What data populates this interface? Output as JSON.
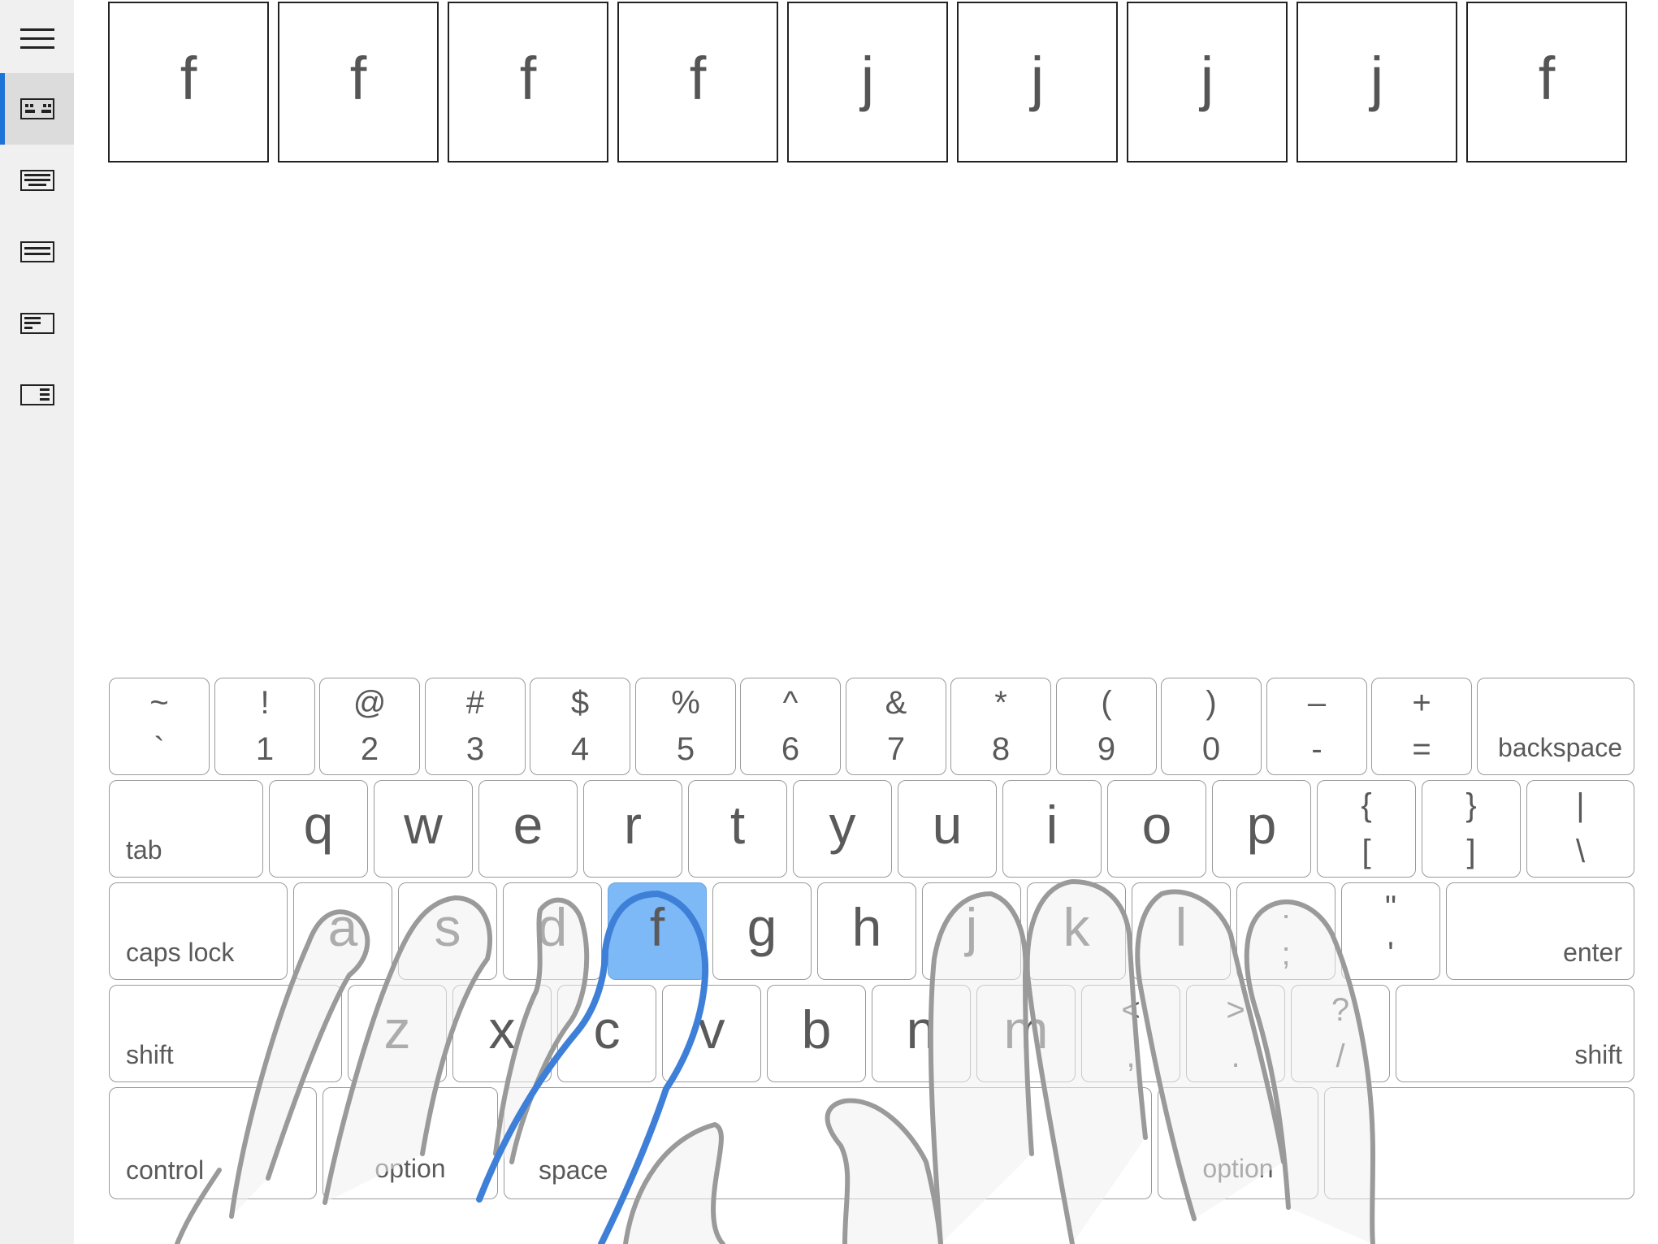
{
  "sidebar": {
    "icons": [
      {
        "name": "menu-icon",
        "active": false
      },
      {
        "name": "keyboard-home-row-icon",
        "active": true
      },
      {
        "name": "keyboard-full-icon",
        "active": false
      },
      {
        "name": "keyboard-bottom-row-icon",
        "active": false
      },
      {
        "name": "keyboard-numpad-icon",
        "active": false
      },
      {
        "name": "keyboard-right-icon",
        "active": false
      }
    ]
  },
  "exercise": {
    "letters": [
      "f",
      "f",
      "f",
      "f",
      "j",
      "j",
      "j",
      "j",
      "f"
    ]
  },
  "keyboard": {
    "highlight_color": "#7db8f7",
    "number_row": [
      {
        "top": "~",
        "bottom": "`"
      },
      {
        "top": "!",
        "bottom": "1"
      },
      {
        "top": "@",
        "bottom": "2"
      },
      {
        "top": "#",
        "bottom": "3"
      },
      {
        "top": "$",
        "bottom": "4"
      },
      {
        "top": "%",
        "bottom": "5"
      },
      {
        "top": "^",
        "bottom": "6"
      },
      {
        "top": "&",
        "bottom": "7"
      },
      {
        "top": "*",
        "bottom": "8"
      },
      {
        "top": "(",
        "bottom": "9"
      },
      {
        "top": ")",
        "bottom": "0"
      },
      {
        "top": "–",
        "bottom": "-"
      },
      {
        "top": "+",
        "bottom": "="
      }
    ],
    "backspace": "backspace",
    "tab": "tab",
    "top_row": [
      "q",
      "w",
      "e",
      "r",
      "t",
      "y",
      "u",
      "i",
      "o",
      "p"
    ],
    "top_row_symbols": [
      {
        "top": "{",
        "bottom": "["
      },
      {
        "top": "}",
        "bottom": "]"
      },
      {
        "top": "|",
        "bottom": "\\"
      }
    ],
    "caps_lock": "caps lock",
    "home_row": [
      "a",
      "s",
      "d",
      "f",
      "g",
      "h",
      "j",
      "k",
      "l"
    ],
    "home_row_symbols": [
      {
        "top": ":",
        "bottom": ";"
      },
      {
        "top": "\"",
        "bottom": "'"
      }
    ],
    "enter": "enter",
    "shift_left": "shift",
    "bottom_row": [
      "z",
      "x",
      "c",
      "v",
      "b",
      "n",
      "m"
    ],
    "bottom_row_symbols": [
      {
        "top": "<",
        "bottom": ","
      },
      {
        "top": ">",
        "bottom": "."
      },
      {
        "top": "?",
        "bottom": "/"
      }
    ],
    "shift_right": "shift",
    "control": "control",
    "option_left": "option",
    "space": "space",
    "option_right": "option",
    "active_key": "f"
  }
}
